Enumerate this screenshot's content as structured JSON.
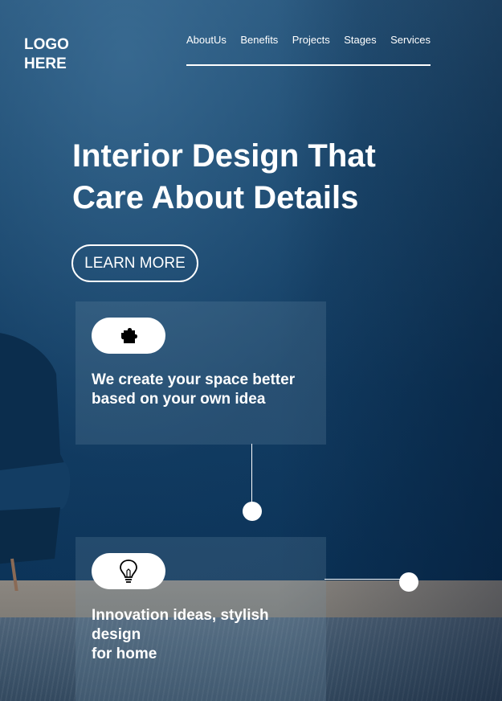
{
  "logo": {
    "text": "LOGO\nHERE"
  },
  "nav": {
    "items": [
      "AboutUs",
      "Benefits",
      "Projects",
      "Stages",
      "Services"
    ]
  },
  "hero": {
    "title": "Interior Design That Care About Details",
    "cta_label": "LEARN MORE"
  },
  "cards": [
    {
      "icon": "puzzle-icon",
      "text": "We create your space better\nbased on your own idea"
    },
    {
      "icon": "lightbulb-icon",
      "text": "Innovation ideas, stylish design\nfor home"
    }
  ],
  "colors": {
    "background": "#0f3a60",
    "accent": "#ffffff"
  }
}
